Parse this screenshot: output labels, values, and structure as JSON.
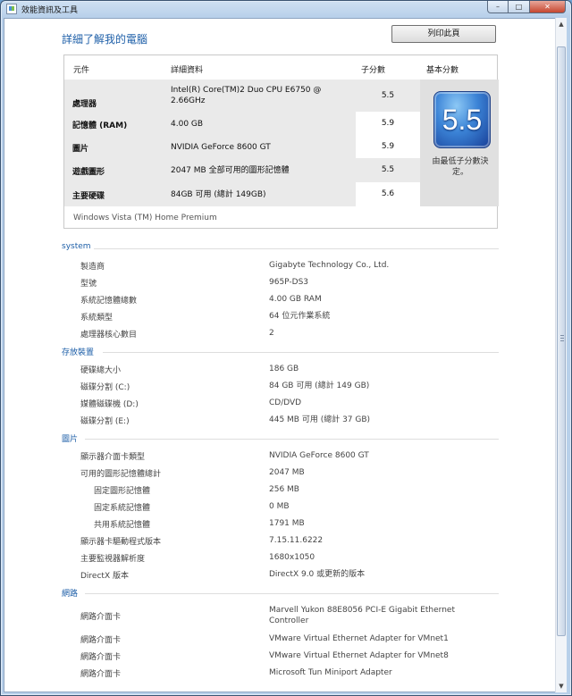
{
  "window": {
    "title": "效能資訊及工具",
    "min_symbol": "–",
    "max_symbol": "□",
    "close_symbol": "✕"
  },
  "header": {
    "title": "詳細了解我的電腦",
    "print_label": "列印此頁"
  },
  "score_table": {
    "col_component": "元件",
    "col_detail": "詳細資料",
    "col_subscore": "子分數",
    "col_base": "基本分數",
    "rows": [
      {
        "component": "處理器",
        "detail": "Intel(R) Core(TM)2 Duo CPU E6750 @ 2.66GHz",
        "subscore": "5.5"
      },
      {
        "component": "記憶體 (RAM)",
        "detail": "4.00 GB",
        "subscore": "5.9"
      },
      {
        "component": "圖片",
        "detail": "NVIDIA GeForce 8600 GT",
        "subscore": "5.9"
      },
      {
        "component": "遊戲圖形",
        "detail": "2047 MB 全部可用的圖形記憶體",
        "subscore": "5.5"
      },
      {
        "component": "主要硬碟",
        "detail": "84GB 可用 (總計 149GB)",
        "subscore": "5.6"
      }
    ],
    "base_score": "5.5",
    "base_caption": "由最低子分數決定。",
    "os_edition": "Windows Vista (TM) Home Premium"
  },
  "sections": {
    "system": {
      "title": "system",
      "rows": [
        {
          "label": "製造商",
          "value": "Gigabyte Technology Co., Ltd."
        },
        {
          "label": "型號",
          "value": "965P-DS3"
        },
        {
          "label": "系統記憶體總數",
          "value": "4.00 GB RAM"
        },
        {
          "label": "系統類型",
          "value": "64 位元作業系統"
        },
        {
          "label": "處理器核心數目",
          "value": "2"
        }
      ]
    },
    "storage": {
      "title": "存放裝置",
      "rows": [
        {
          "label": "硬碟總大小",
          "value": "186 GB"
        },
        {
          "label": "磁碟分割 (C:)",
          "value": "84 GB 可用 (總計 149 GB)"
        },
        {
          "label": "媒體磁碟機 (D:)",
          "value": "CD/DVD"
        },
        {
          "label": "磁碟分割 (E:)",
          "value": "445 MB 可用 (總計 37 GB)"
        }
      ]
    },
    "graphics": {
      "title": "圖片",
      "rows": [
        {
          "label": "顯示器介面卡類型",
          "value": "NVIDIA GeForce 8600 GT"
        },
        {
          "label": "可用的圖形記憶體總計",
          "value": "2047 MB"
        },
        {
          "label": "固定圖形記憶體",
          "value": "256 MB"
        },
        {
          "label": "固定系統記憶體",
          "value": "0 MB"
        },
        {
          "label": "共用系統記憶體",
          "value": "1791 MB"
        },
        {
          "label": "顯示器卡驅動程式版本",
          "value": "7.15.11.6222"
        },
        {
          "label": "主要監視器解析度",
          "value": "1680x1050"
        },
        {
          "label": "DirectX 版本",
          "value": "DirectX 9.0 或更新的版本"
        }
      ]
    },
    "network": {
      "title": "網路",
      "rows": [
        {
          "label": "網路介面卡",
          "value": "Marvell Yukon 88E8056 PCI-E Gigabit Ethernet Controller"
        },
        {
          "label": "網路介面卡",
          "value": "VMware Virtual Ethernet Adapter for VMnet1"
        },
        {
          "label": "網路介面卡",
          "value": "VMware Virtual Ethernet Adapter for VMnet8"
        },
        {
          "label": "網路介面卡",
          "value": "Microsoft Tun Miniport Adapter"
        }
      ]
    }
  },
  "scrollbar": {
    "up_symbol": "▲",
    "down_symbol": "▼"
  },
  "colors": {
    "heading_blue": "#1e5fa8",
    "score_badge": "#3b83d6"
  }
}
